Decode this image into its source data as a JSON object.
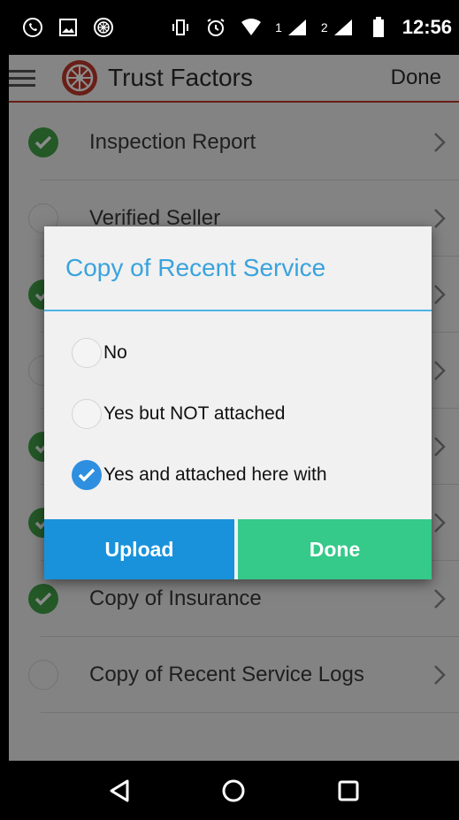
{
  "status_bar": {
    "time": "12:56",
    "sim1": "1",
    "sim2": "2"
  },
  "app_bar": {
    "title": "Trust Factors",
    "done_label": "Done"
  },
  "colors": {
    "accent_red": "#c0392b",
    "check_green": "#43a047",
    "dialog_blue": "#3aa3dd",
    "upload_blue": "#1992db",
    "done_green": "#35c98a"
  },
  "list": {
    "items": [
      {
        "label": "Inspection Report",
        "checked": true
      },
      {
        "label": "Verified Seller",
        "checked": false
      },
      {
        "label": "",
        "checked": true
      },
      {
        "label": "",
        "checked": false
      },
      {
        "label": "",
        "checked": true
      },
      {
        "label": "",
        "checked": true
      },
      {
        "label": "Copy of Insurance",
        "checked": true
      },
      {
        "label": "Copy of Recent Service Logs",
        "checked": false
      }
    ]
  },
  "dialog": {
    "title": "Copy of Recent Service",
    "options": [
      {
        "label": "No",
        "selected": false
      },
      {
        "label": "Yes but NOT attached",
        "selected": false
      },
      {
        "label": "Yes and attached here with",
        "selected": true
      }
    ],
    "upload_label": "Upload",
    "done_label": "Done"
  }
}
